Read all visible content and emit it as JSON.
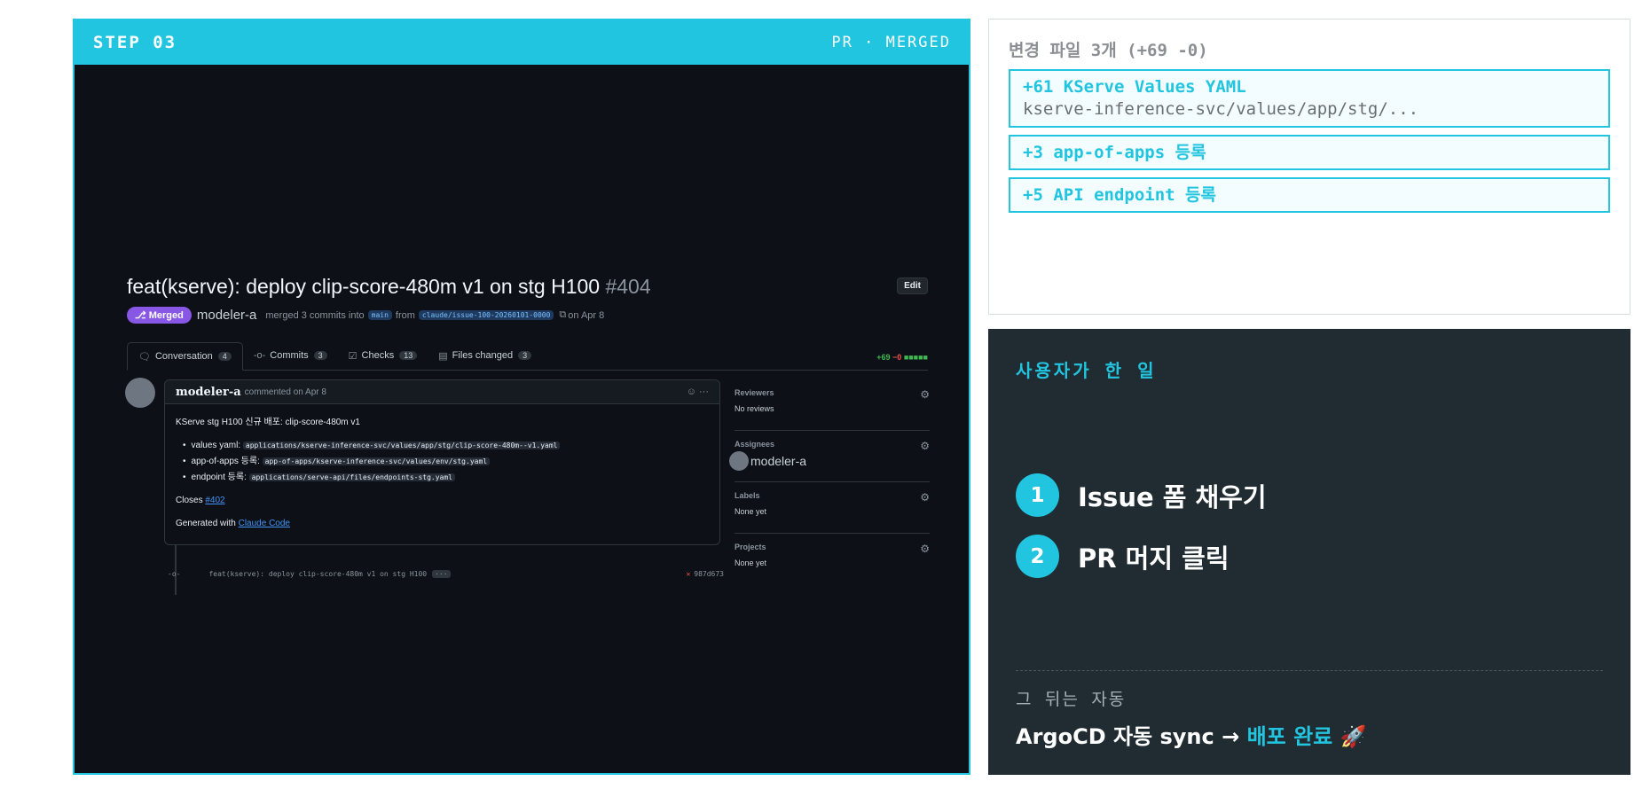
{
  "step_panel": {
    "step_label": "STEP 03",
    "status_label": "PR · MERGED"
  },
  "pr": {
    "title": "feat(kserve): deploy clip-score-480m v1 on stg H100",
    "number": "#404",
    "edit_label": "Edit",
    "state_badge": "Merged",
    "author": "modeler-a",
    "merge_text": "merged 3 commits into",
    "base_branch": "main",
    "from_text": "from",
    "head_branch": "claude/issue-100-20260101-0000",
    "date_text": "on Apr 8",
    "tabs": [
      {
        "label": "Conversation",
        "count": "4"
      },
      {
        "label": "Commits",
        "count": "3"
      },
      {
        "label": "Checks",
        "count": "13"
      },
      {
        "label": "Files changed",
        "count": "3"
      }
    ],
    "diffstat_add": "+69",
    "diffstat_del": "−0",
    "diffstat_blocks": "■■■■■",
    "comment": {
      "author": "modeler-a",
      "meta": "commented on Apr 8",
      "actions": "☺ ···",
      "intro": "KServe stg H100 신규 배포: clip-score-480m v1",
      "items": [
        {
          "label": "values yaml:",
          "code": "applications/kserve-inference-svc/values/app/stg/clip-score-480m--v1.yaml"
        },
        {
          "label": "app-of-apps 등록:",
          "code": "app-of-apps/kserve-inference-svc/values/env/stg.yaml"
        },
        {
          "label": "endpoint 등록:",
          "code": "applications/serve-api/files/endpoints-stg.yaml"
        }
      ],
      "closes_label": "Closes",
      "closes_ref": "#402",
      "generated_label": "Generated with",
      "generated_link": "Claude Code"
    },
    "commit": {
      "message": "feat(kserve): deploy clip-score-480m v1 on stg H100",
      "more": "···",
      "status": "✕",
      "sha": "987d673"
    },
    "sidebar": {
      "reviewers_label": "Reviewers",
      "reviewers_value": "No reviews",
      "assignees_label": "Assignees",
      "assignee": "modeler-a",
      "labels_label": "Labels",
      "labels_value": "None yet",
      "projects_label": "Projects",
      "projects_value": "None yet"
    }
  },
  "files_panel": {
    "title": "변경 파일 3개 (+69 -0)",
    "files": [
      {
        "header": "+61 KServe Values YAML",
        "path": "kserve-inference-svc/values/app/stg/..."
      },
      {
        "header": "+3 app-of-apps 등록"
      },
      {
        "header": "+5 API endpoint 등록"
      }
    ]
  },
  "user_panel": {
    "title": "사용자가 한 일",
    "steps": [
      {
        "num": "1",
        "text": "Issue 폼 채우기"
      },
      {
        "num": "2",
        "text": "PR 머지 클릭"
      }
    ],
    "after_label": "그 뒤는 자동",
    "after_prefix": "ArgoCD 자동 sync →",
    "after_highlight": "배포 완료",
    "after_emoji": "🚀"
  },
  "colors": {
    "accent": "#22c5e0",
    "merged_purple": "#8957e5",
    "dark_panel": "#212c32",
    "github_dark": "#0d1117"
  }
}
